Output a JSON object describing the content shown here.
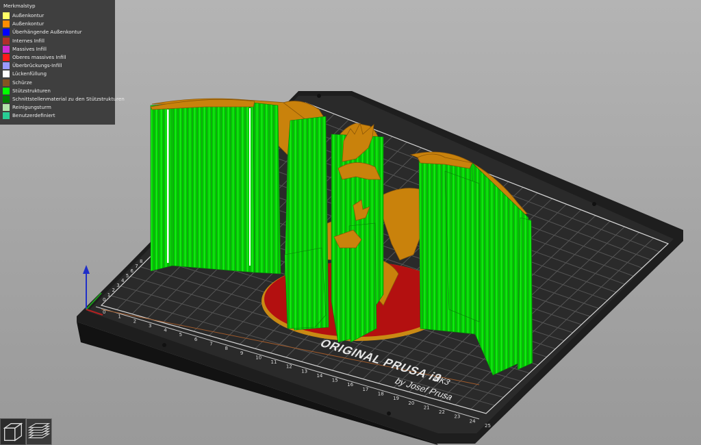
{
  "legend": {
    "title": "Merkmalstyp",
    "items": [
      {
        "label": "Außenkontur",
        "color": "#ffff66"
      },
      {
        "label": "Außenkontur",
        "color": "#ff8c00"
      },
      {
        "label": "Überhängende Außenkontur",
        "color": "#0000ff"
      },
      {
        "label": "Internes Infill",
        "color": "#b03029"
      },
      {
        "label": "Massives Infill",
        "color": "#d22cd2"
      },
      {
        "label": "Oberes massives Infill",
        "color": "#ff1a1a"
      },
      {
        "label": "Überbrückungs-Infill",
        "color": "#9999ff"
      },
      {
        "label": "Lückenfüllung",
        "color": "#ffffff"
      },
      {
        "label": "Schürze",
        "color": "#845321"
      },
      {
        "label": "Stützstrukturen",
        "color": "#00ff00"
      },
      {
        "label": "Schnittstellenmaterial zu den Stützstrukturen",
        "color": "#008000"
      },
      {
        "label": "Reinigungsturm",
        "color": "#b3e3ab"
      },
      {
        "label": "Benutzerdefiniert",
        "color": "#28cc94"
      }
    ]
  },
  "bed": {
    "brand_line1": "ORIGINAL PRUSA i3",
    "brand_model": "MK3",
    "brand_line2": "by Josef Prusa",
    "front_ticks": [
      "0",
      "1",
      "2",
      "3",
      "4",
      "5",
      "6",
      "7",
      "8",
      "9",
      "10",
      "11",
      "12",
      "13",
      "14",
      "15",
      "16",
      "17",
      "18",
      "19",
      "20",
      "21",
      "22",
      "23",
      "24",
      "25"
    ],
    "left_ticks": [
      "0",
      "1",
      "2",
      "3",
      "4",
      "5",
      "6",
      "7",
      "8"
    ]
  },
  "view_buttons": [
    {
      "name": "3d-view",
      "icon": "cube-icon"
    },
    {
      "name": "layer-view",
      "icon": "layers-icon"
    }
  ]
}
